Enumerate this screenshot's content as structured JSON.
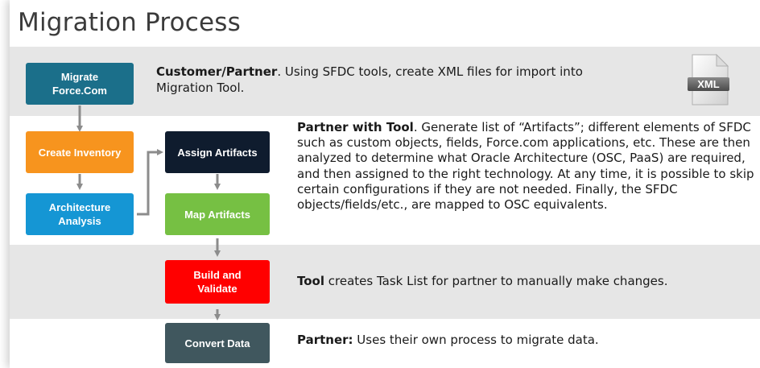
{
  "title": "Migration Process",
  "steps": {
    "migrate": "Migrate\nForce.Com",
    "inventory": "Create Inventory",
    "architecture": "Architecture\nAnalysis",
    "assign": "Assign Artifacts",
    "map": "Map Artifacts",
    "build": "Build and\nValidate",
    "convert": "Convert Data"
  },
  "descriptions": {
    "row1_bold": "Customer/Partner",
    "row1_text": ".  Using SFDC tools, create XML files for import into Migration Tool.",
    "row2_bold": "Partner with Tool",
    "row2_text": ".  Generate list of  “Artifacts”; different elements of SFDC such as custom objects, fields, Force.com applications, etc.  These are then analyzed to determine what Oracle Architecture (OSC, PaaS) are required, and then assigned to the right technology.  At any time, it is possible to skip certain configurations if they are not needed.  Finally, the SFDC objects/fields/etc., are mapped to OSC equivalents.",
    "row3_bold": "Tool",
    "row3_text": " creates Task List for partner to manually make changes.",
    "row4_bold": "Partner:",
    "row4_text": " Uses their own process to migrate data."
  },
  "xml_icon": {
    "label": "XML",
    "icon": "xml-file-icon"
  },
  "colors": {
    "migrate": "#1b6f8a",
    "inventory": "#f7941e",
    "architecture": "#1596d4",
    "assign": "#0f1c2e",
    "map": "#76c043",
    "build": "#ff0000",
    "convert": "#40575e",
    "band_gray": "#e6e6e6",
    "arrow": "#8c8c8c"
  }
}
